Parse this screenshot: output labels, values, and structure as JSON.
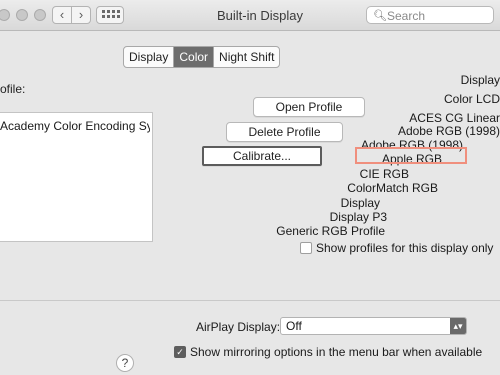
{
  "window": {
    "title": "Built-in Display"
  },
  "toolbar": {
    "back": "‹",
    "forward": "›"
  },
  "search": {
    "placeholder": "Search",
    "icon": "search-icon"
  },
  "tabs": [
    {
      "label": "Display",
      "active": false
    },
    {
      "label": "Color",
      "active": true
    },
    {
      "label": "Night Shift",
      "active": false
    }
  ],
  "color_pane": {
    "profile_label": "ofile:",
    "profiles": [
      "Academy Color Encoding Sy..."
    ],
    "buttons": {
      "open_profile": "Open Profile",
      "delete_profile": "Delete Profile",
      "calibrate": "Calibrate..."
    },
    "show_profiles_label": "Show profiles for this display only",
    "show_profiles_checked": false
  },
  "profile_menu": {
    "items": [
      "Display",
      "Color LCD",
      "ACES CG Linear",
      "Adobe RGB (1998)",
      "Adobe RGB (1998)",
      "Apple RGB",
      "CIE RGB",
      "ColorMatch RGB",
      "Display",
      "Display P3",
      "Generic RGB Profile"
    ],
    "highlighted_index": 5,
    "highlight_color": "#f08f7d"
  },
  "airplay": {
    "label": "AirPlay Display:",
    "value": "Off",
    "show_mirroring_label": "Show mirroring options in the menu bar when available",
    "show_mirroring_checked": true
  },
  "help": {
    "label": "?"
  },
  "colors": {
    "selected_tab": "#6d6d6d",
    "window_bg": "#e7e7e7"
  }
}
